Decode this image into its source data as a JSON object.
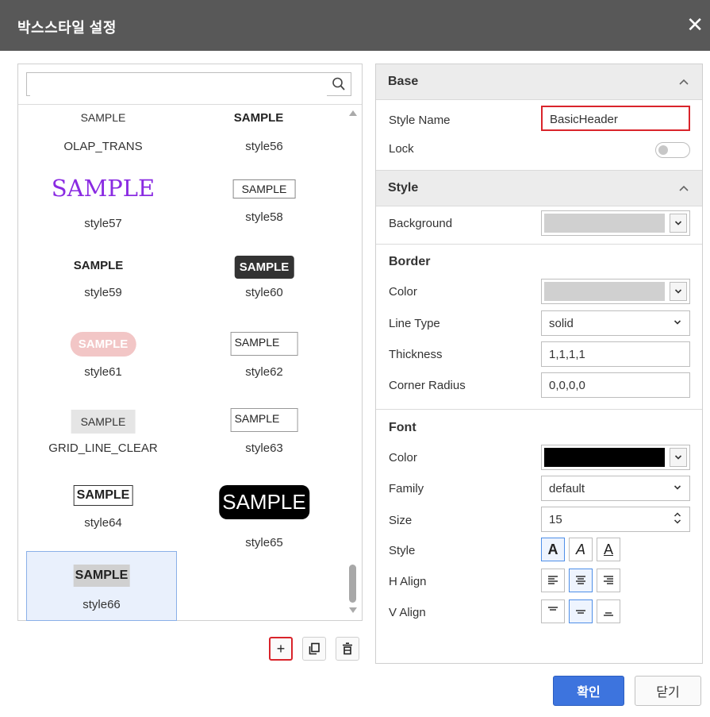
{
  "dialog": {
    "title": "박스스타일 설정"
  },
  "search": {
    "placeholder": "",
    "value": ""
  },
  "styles": [
    {
      "sample": "SAMPLE",
      "name": "OLAP_TRANS"
    },
    {
      "sample": "SAMPLE",
      "name": "style56"
    },
    {
      "sample": "SAMPLE",
      "name": "style57"
    },
    {
      "sample": "SAMPLE",
      "name": "style58"
    },
    {
      "sample": "SAMPLE",
      "name": "style59"
    },
    {
      "sample": "SAMPLE",
      "name": "style60"
    },
    {
      "sample": "SAMPLE",
      "name": "style61"
    },
    {
      "sample": "SAMPLE",
      "name": "style62"
    },
    {
      "sample": "SAMPLE",
      "name": "GRID_LINE_CLEAR"
    },
    {
      "sample": "SAMPLE",
      "name": "style63"
    },
    {
      "sample": "SAMPLE",
      "name": "style64"
    },
    {
      "sample": "SAMPLE",
      "name": "style65"
    },
    {
      "sample": "SAMPLE",
      "name": "style66"
    }
  ],
  "selected_style": "style66",
  "base": {
    "title": "Base",
    "style_name_label": "Style Name",
    "style_name_value": "BasicHeader",
    "lock_label": "Lock",
    "lock_on": false
  },
  "style": {
    "title": "Style",
    "background_label": "Background",
    "background_color": "#d0d0d0"
  },
  "border": {
    "title": "Border",
    "color_label": "Color",
    "color_value": "#d0d0d0",
    "line_type_label": "Line Type",
    "line_type_value": "solid",
    "thickness_label": "Thickness",
    "thickness_value": "1,1,1,1",
    "corner_radius_label": "Corner Radius",
    "corner_radius_value": "0,0,0,0"
  },
  "font": {
    "title": "Font",
    "color_label": "Color",
    "color_value": "#000000",
    "family_label": "Family",
    "family_value": "default",
    "size_label": "Size",
    "size_value": "15",
    "style_label": "Style",
    "halign_label": "H Align",
    "valign_label": "V Align",
    "style_bold": true,
    "halign_selected": "center",
    "valign_selected": "middle"
  },
  "buttons": {
    "ok": "확인",
    "close": "닫기"
  },
  "colors": {
    "titlebar": "#585858",
    "accent": "#3d74de",
    "highlight_red": "#d9242b"
  }
}
